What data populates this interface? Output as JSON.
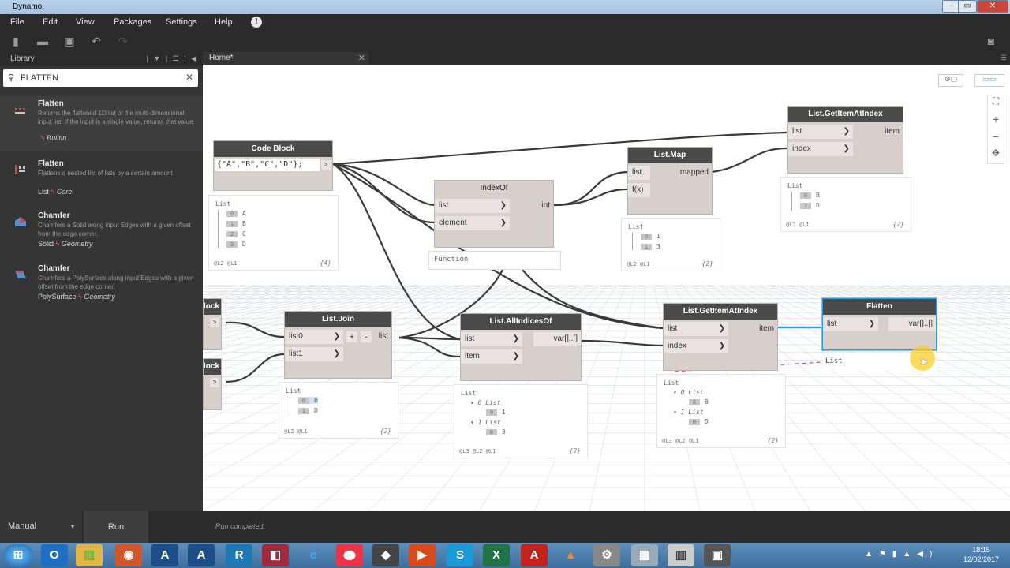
{
  "window": {
    "title": "Dynamo"
  },
  "menu": [
    "File",
    "Edit",
    "View",
    "Packages",
    "Settings",
    "Help"
  ],
  "library": {
    "title": "Library",
    "search_value": "FLATTEN",
    "results": [
      {
        "name": "Flatten",
        "desc": "Returns the flattened 1D list of the multi-dimensional input list. If the input is a single value, returns that value.",
        "category": "",
        "sub": "BuiltIn"
      },
      {
        "name": "Flatten",
        "desc": "Flattens a nested list of lists by a certain amount.",
        "category": "List",
        "sub": "Core"
      },
      {
        "name": "Chamfer",
        "desc": "Chamfers a Solid along input Edges with a given offset from the edge corner.",
        "category": "Solid",
        "sub": "Geometry"
      },
      {
        "name": "Chamfer",
        "desc": "Chamfers a PolySurface along input Edges with a given offset from the edge corner.",
        "category": "PolySurface",
        "sub": "Geometry"
      }
    ]
  },
  "tab": {
    "label": "Home*"
  },
  "nodes": {
    "codeblock": {
      "title": "Code Block",
      "code": "{\"A\",\"B\",\"C\",\"D\"};",
      "out": ">"
    },
    "indexof": {
      "title": "IndexOf",
      "in1": "list",
      "in2": "element",
      "out": "int",
      "extra": "Function"
    },
    "listmap": {
      "title": "List.Map",
      "in1": "list",
      "in2": "f(x)",
      "out": "mapped"
    },
    "getitem_top": {
      "title": "List.GetItemAtIndex",
      "in1": "list",
      "in2": "index",
      "out": "item"
    },
    "block1": {
      "title": "lock",
      "out": ">"
    },
    "block2": {
      "title": "lock",
      "out": ">"
    },
    "listjoin": {
      "title": "List.Join",
      "in1": "list0",
      "in2": "list1",
      "out": "list",
      "plus": "+",
      "minus": "-"
    },
    "allindices": {
      "title": "List.AllIndicesOf",
      "in1": "list",
      "in2": "item",
      "out": "var[]..[]"
    },
    "getitem_mid": {
      "title": "List.GetItemAtIndex",
      "in1": "list",
      "in2": "index",
      "out": "item"
    },
    "flatten": {
      "title": "Flatten",
      "in1": "list",
      "out": "var[]..[]",
      "preview": "List"
    }
  },
  "previews": {
    "codeblock": {
      "head": "List",
      "items": [
        [
          "0",
          "A"
        ],
        [
          "1",
          "B"
        ],
        [
          "2",
          "C"
        ],
        [
          "3",
          "D"
        ]
      ],
      "foot": "@L2 @L1",
      "count": "{4}"
    },
    "listmap": {
      "head": "List",
      "items": [
        [
          "0",
          "1"
        ],
        [
          "1",
          "3"
        ]
      ],
      "foot": "@L2 @L1",
      "count": "{2}"
    },
    "getitem_top": {
      "head": "List",
      "items": [
        [
          "0",
          "B"
        ],
        [
          "1",
          "D"
        ]
      ],
      "foot": "@L2 @L1",
      "count": "{2}"
    },
    "listjoin": {
      "head": "List",
      "items": [
        [
          "0",
          "B"
        ],
        [
          "1",
          "D"
        ]
      ],
      "foot": "@L2 @L1",
      "count": "{2}"
    },
    "allindices": {
      "head": "List",
      "sub0": "0 List",
      "sub0v": [
        "0",
        "1"
      ],
      "sub1": "1 List",
      "sub1v": [
        "0",
        "3"
      ],
      "foot": "@L3 @L2 @L1",
      "count": "{2}"
    },
    "getitem_mid": {
      "head": "List",
      "sub0": "0 List",
      "sub0v": [
        "0",
        "B"
      ],
      "sub1": "1 List",
      "sub1v": [
        "0",
        "D"
      ],
      "foot": "@L3 @L2 @L1",
      "count": "{2}"
    }
  },
  "bottom": {
    "run_mode": "Manual",
    "run_label": "Run",
    "status": "Run completed."
  },
  "taskbar": {
    "time": "18:15",
    "date": "12/02/2017"
  },
  "colors": {
    "accent": "#2f9be0",
    "node_header": "#4a4a4a",
    "node_body": "#d7cfcb"
  }
}
